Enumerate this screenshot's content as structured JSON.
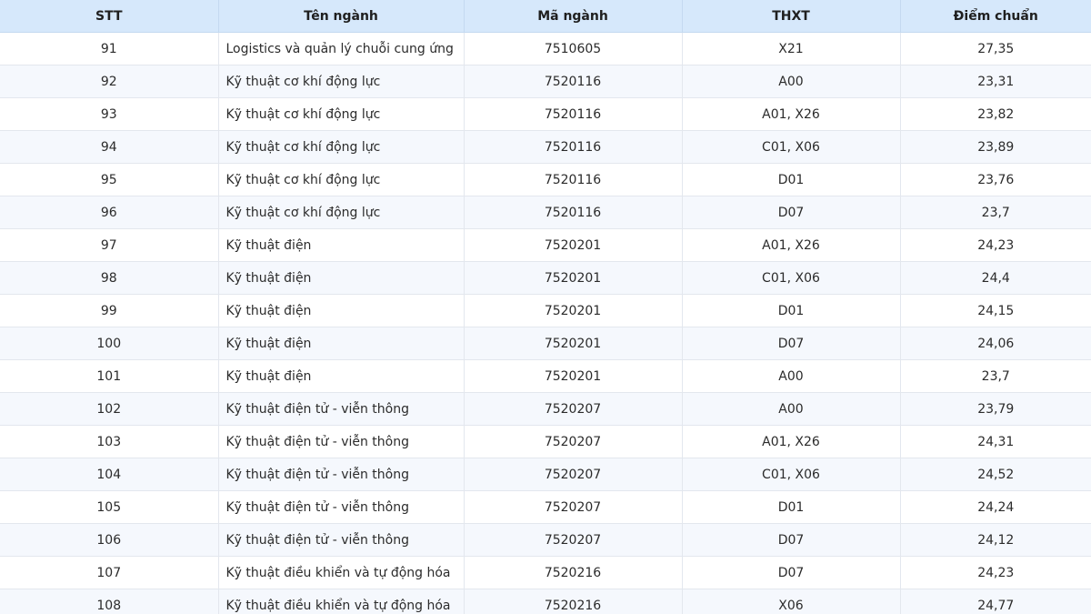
{
  "table": {
    "headers": [
      "STT",
      "Tên ngành",
      "Mã ngành",
      "THXT",
      "Điểm chuẩn"
    ],
    "rows": [
      [
        "91",
        "Logistics và quản lý chuỗi cung ứng",
        "7510605",
        "X21",
        "27,35"
      ],
      [
        "92",
        "Kỹ thuật cơ khí động lực",
        "7520116",
        "A00",
        "23,31"
      ],
      [
        "93",
        "Kỹ thuật cơ khí động lực",
        "7520116",
        "A01, X26",
        "23,82"
      ],
      [
        "94",
        "Kỹ thuật cơ khí động lực",
        "7520116",
        "C01, X06",
        "23,89"
      ],
      [
        "95",
        "Kỹ thuật cơ khí động lực",
        "7520116",
        "D01",
        "23,76"
      ],
      [
        "96",
        "Kỹ thuật cơ khí động lực",
        "7520116",
        "D07",
        "23,7"
      ],
      [
        "97",
        "Kỹ thuật điện",
        "7520201",
        "A01, X26",
        "24,23"
      ],
      [
        "98",
        "Kỹ thuật điện",
        "7520201",
        "C01, X06",
        "24,4"
      ],
      [
        "99",
        "Kỹ thuật điện",
        "7520201",
        "D01",
        "24,15"
      ],
      [
        "100",
        "Kỹ thuật điện",
        "7520201",
        "D07",
        "24,06"
      ],
      [
        "101",
        "Kỹ thuật điện",
        "7520201",
        "A00",
        "23,7"
      ],
      [
        "102",
        "Kỹ thuật điện tử - viễn thông",
        "7520207",
        "A00",
        "23,79"
      ],
      [
        "103",
        "Kỹ thuật điện tử - viễn thông",
        "7520207",
        "A01, X26",
        "24,31"
      ],
      [
        "104",
        "Kỹ thuật điện tử - viễn thông",
        "7520207",
        "C01, X06",
        "24,52"
      ],
      [
        "105",
        "Kỹ thuật điện tử - viễn thông",
        "7520207",
        "D01",
        "24,24"
      ],
      [
        "106",
        "Kỹ thuật điện tử - viễn thông",
        "7520207",
        "D07",
        "24,12"
      ],
      [
        "107",
        "Kỹ thuật điều khiển và tự động hóa",
        "7520216",
        "D07",
        "24,23"
      ],
      [
        "108",
        "Kỹ thuật điều khiển và tự động hóa",
        "7520216",
        "X06",
        "24,77"
      ]
    ]
  }
}
